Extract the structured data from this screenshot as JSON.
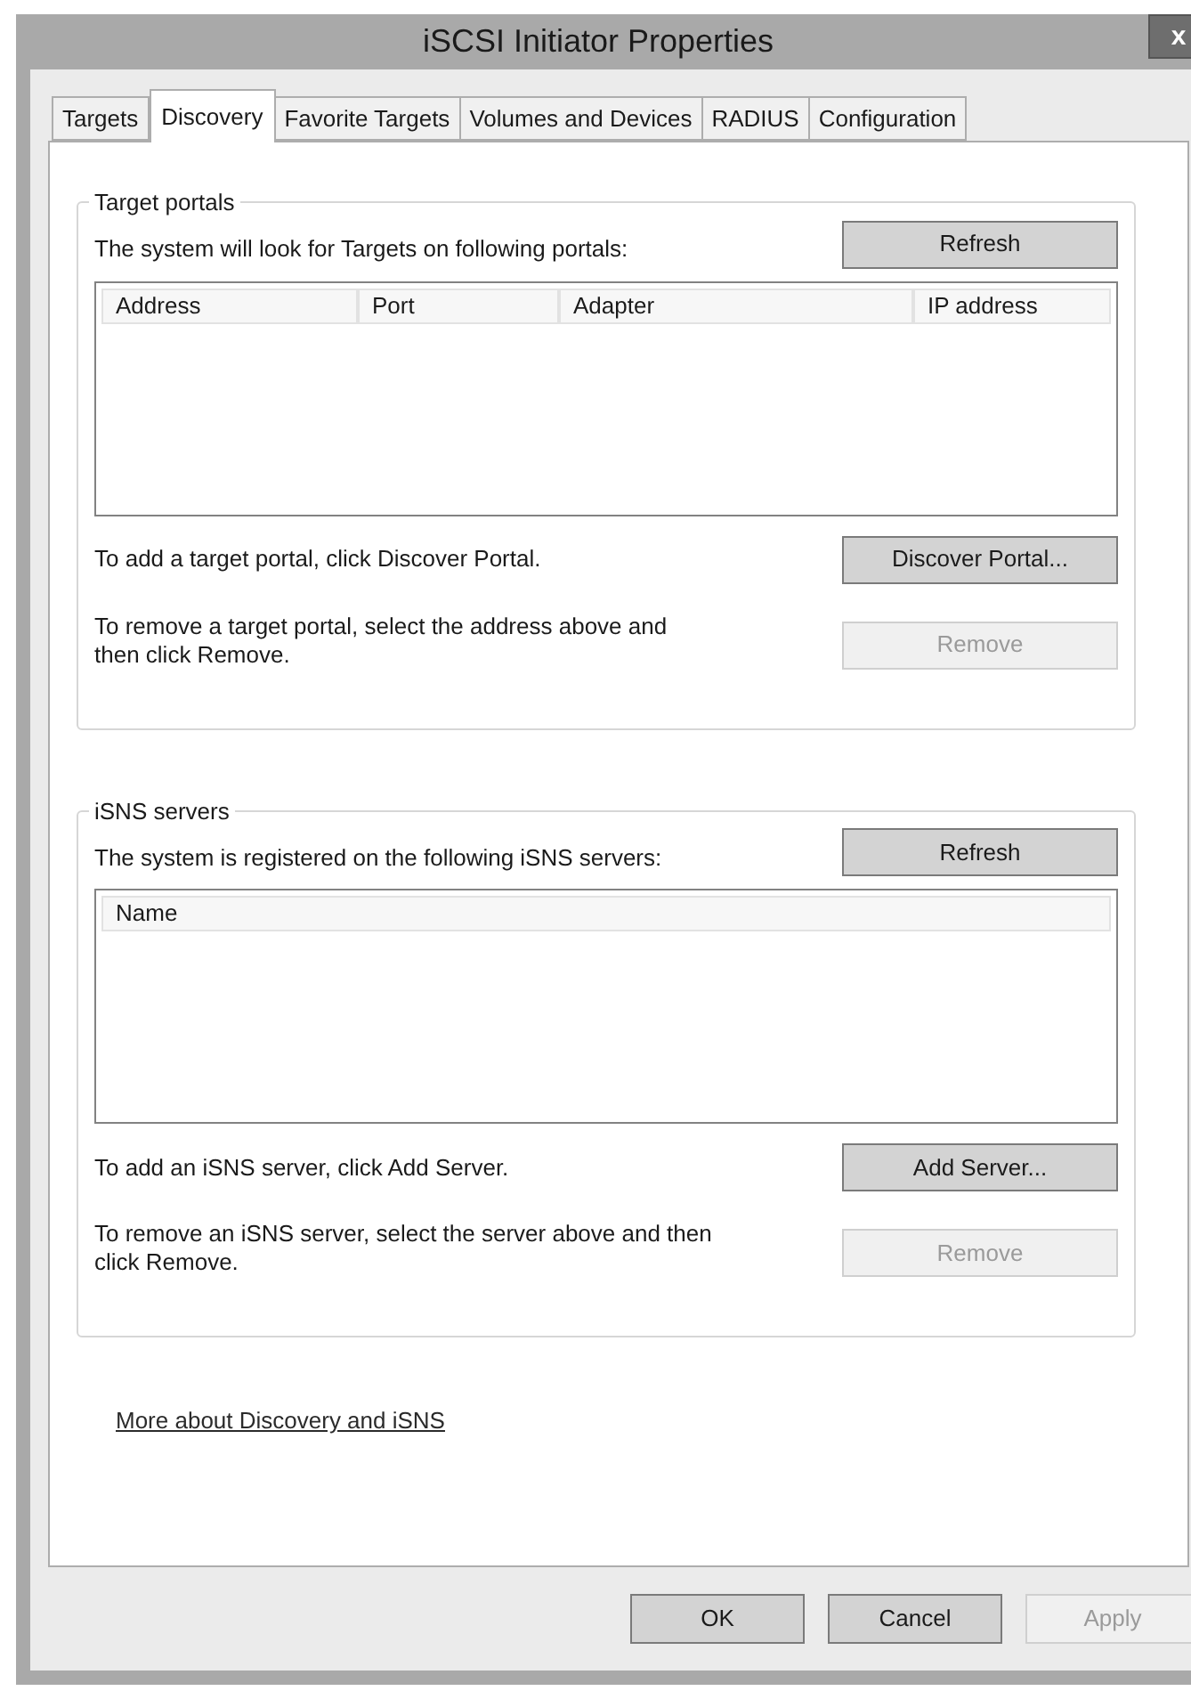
{
  "window": {
    "title": "iSCSI Initiator Properties",
    "close": "x"
  },
  "tabs": [
    {
      "label": "Targets",
      "selected": false
    },
    {
      "label": "Discovery",
      "selected": true
    },
    {
      "label": "Favorite Targets",
      "selected": false
    },
    {
      "label": "Volumes and Devices",
      "selected": false
    },
    {
      "label": "RADIUS",
      "selected": false
    },
    {
      "label": "Configuration",
      "selected": false
    }
  ],
  "groups": [
    {
      "legend": "Target portals",
      "description": "The system will look for Targets on following portals:",
      "refresh": {
        "label": "Refresh",
        "disabled": false
      },
      "columns": [
        "Address",
        "Port",
        "Adapter",
        "IP address"
      ],
      "add_text": "To add a target portal, click Discover Portal.",
      "add_button": {
        "label": "Discover Portal...",
        "disabled": false
      },
      "remove_text": "To remove a target portal, select the address above and then click Remove.",
      "remove_button": {
        "label": "Remove",
        "disabled": true
      }
    },
    {
      "legend": "iSNS servers",
      "description": "The system is registered on the following iSNS servers:",
      "refresh": {
        "label": "Refresh",
        "disabled": false
      },
      "columns": [
        "Name"
      ],
      "add_text": "To add an iSNS server, click Add Server.",
      "add_button": {
        "label": "Add Server...",
        "disabled": false
      },
      "remove_text": "To remove an iSNS server, select the server above and then click Remove.",
      "remove_button": {
        "label": "Remove",
        "disabled": true
      }
    }
  ],
  "link": "More about Discovery and iSNS",
  "buttons": [
    {
      "label": "OK",
      "disabled": false
    },
    {
      "label": "Cancel",
      "disabled": false
    },
    {
      "label": "Apply",
      "disabled": true
    }
  ]
}
